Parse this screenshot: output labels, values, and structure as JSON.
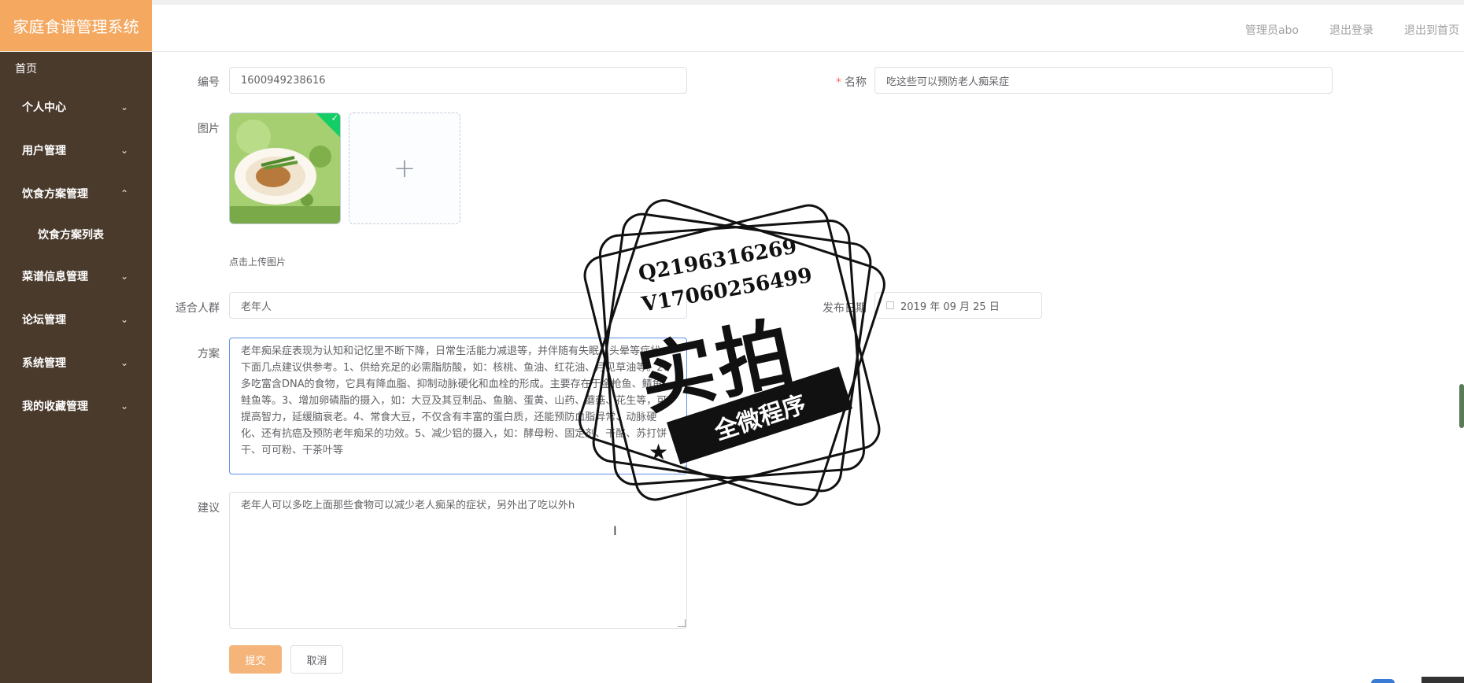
{
  "sidebar": {
    "brand": "家庭食谱管理系统",
    "home": "首页",
    "items": [
      {
        "label": "个人中心",
        "chevron": "chevron-down"
      },
      {
        "label": "用户管理",
        "chevron": "chevron-down"
      },
      {
        "label": "饮食方案管理",
        "chevron": "chevron-up"
      },
      {
        "label": "菜谱信息管理",
        "chevron": "chevron-down"
      },
      {
        "label": "论坛管理",
        "chevron": "chevron-down"
      },
      {
        "label": "系统管理",
        "chevron": "chevron-down"
      },
      {
        "label": "我的收藏管理",
        "chevron": "chevron-down"
      }
    ],
    "subitem": "饮食方案列表"
  },
  "header": {
    "user": "管理员abo",
    "logout": "退出登录",
    "back_home": "退出到首页"
  },
  "form": {
    "id_label": "编号",
    "id_value": "1600949238616",
    "name_label": "名称",
    "name_value": "吃这些可以预防老人痴呆症",
    "image_label": "图片",
    "upload_tip": "点击上传图片",
    "crowd_label": "适合人群",
    "crowd_value": "老年人",
    "date_label": "发布日期",
    "date_value": "2019 年 09 月 25 日",
    "plan_label": "方案",
    "plan_value": "老年痴呆症表现为认知和记忆里不断下降，日常生活能力减退等，并伴随有失眠、头晕等症状。下面几点建议供参考。1、供给充足的必需脂肪酸，如：核桃、鱼油、红花油、月见草油等。2、多吃富含DNA的食物，它具有降血脂、抑制动脉硬化和血栓的形成。主要存在于金枪鱼、鲭鱼、鲑鱼等。3、增加卵磷脂的摄入，如：大豆及其豆制品、鱼脑、蛋黄、山药、蘑菇、花生等，可提高智力，延缓脑衰老。4、常食大豆，不仅含有丰富的蛋白质，还能预防血脂异常、动脉硬化、还有抗癌及预防老年痴呆的功效。5、减少铝的摄入，如：酵母粉、固定剂、干酪、苏打饼干、可可粉、干茶叶等",
    "advice_label": "建议",
    "advice_value": "老年人可以多吃上面那些食物可以减少老人痴呆的症状，另外出了吃以外h",
    "submit": "提交",
    "cancel": "取消"
  },
  "stamp": {
    "line1": "Q2196316269",
    "line2": "V17060256499",
    "main": "实拍",
    "ribbon": "全微程序"
  },
  "colors": {
    "brand": "#f4a860",
    "sidebar": "#4a3a2c",
    "submit": "#f4b47a"
  }
}
